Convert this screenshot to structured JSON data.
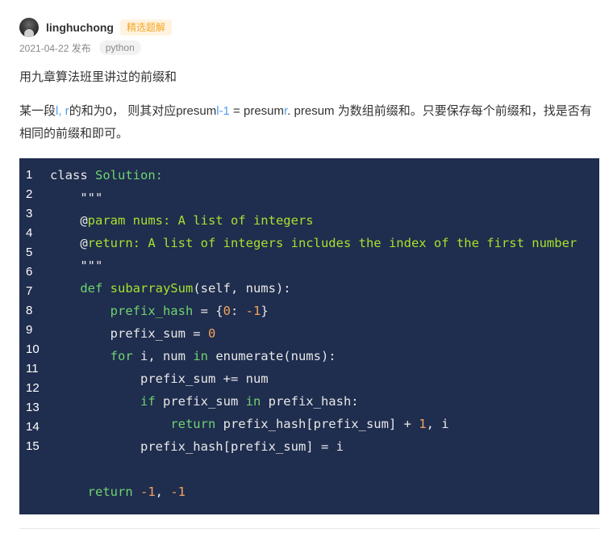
{
  "author": {
    "name": "linghuchong",
    "badge": "精选题解"
  },
  "meta": {
    "date_published": "2021-04-22 发布",
    "tag": "python"
  },
  "title": "用九章算法班里讲过的前缀和",
  "description": {
    "part1": "某一段",
    "hl1": "l, r",
    "part2": "的和为0， 则其对应presum",
    "hl2": "l-1",
    "part3": " = presum",
    "hl3": "r",
    "part4": ". presum 为数组前缀和。只要保存每个前缀和，找是否有相同的前缀和即可。"
  },
  "code": {
    "line_numbers": [
      "1",
      "2",
      "3",
      "4",
      "5",
      "6",
      "7",
      "8",
      "9",
      "10",
      "11",
      "12",
      "13",
      "14",
      "15"
    ],
    "lines": [
      {
        "indent": "",
        "tokens": [
          {
            "t": "class ",
            "c": "var"
          },
          {
            "t": "Solution:",
            "c": "kw"
          }
        ]
      },
      {
        "indent": "    ",
        "tokens": [
          {
            "t": "\"\"\"",
            "c": "var"
          }
        ]
      },
      {
        "indent": "    ",
        "tokens": [
          {
            "t": "@",
            "c": "var"
          },
          {
            "t": "param nums: A list of integers",
            "c": "doc"
          }
        ]
      },
      {
        "indent": "    ",
        "tokens": [
          {
            "t": "@",
            "c": "var"
          },
          {
            "t": "return: A list of integers includes the index of the first number",
            "c": "doc"
          }
        ]
      },
      {
        "indent": "    ",
        "tokens": [
          {
            "t": "\"\"\"",
            "c": "var"
          }
        ]
      },
      {
        "indent": "    ",
        "tokens": [
          {
            "t": "def ",
            "c": "kw"
          },
          {
            "t": "subarraySum",
            "c": "fn"
          },
          {
            "t": "(self, nums):",
            "c": "var"
          }
        ]
      },
      {
        "indent": "        ",
        "tokens": [
          {
            "t": "prefix_hash",
            "c": "kw"
          },
          {
            "t": " = {",
            "c": "var"
          },
          {
            "t": "0",
            "c": "num"
          },
          {
            "t": ": ",
            "c": "var"
          },
          {
            "t": "-1",
            "c": "num"
          },
          {
            "t": "}",
            "c": "var"
          }
        ]
      },
      {
        "indent": "        ",
        "tokens": [
          {
            "t": "prefix_sum = ",
            "c": "var"
          },
          {
            "t": "0",
            "c": "num"
          }
        ]
      },
      {
        "indent": "        ",
        "tokens": [
          {
            "t": "for ",
            "c": "kw"
          },
          {
            "t": "i, num ",
            "c": "var"
          },
          {
            "t": "in ",
            "c": "kw"
          },
          {
            "t": "enumerate(nums):",
            "c": "var"
          }
        ]
      },
      {
        "indent": "            ",
        "tokens": [
          {
            "t": "prefix_sum += num",
            "c": "var"
          }
        ]
      },
      {
        "indent": "            ",
        "tokens": [
          {
            "t": "if ",
            "c": "kw"
          },
          {
            "t": "prefix_sum ",
            "c": "var"
          },
          {
            "t": "in ",
            "c": "kw"
          },
          {
            "t": "prefix_hash:",
            "c": "var"
          }
        ]
      },
      {
        "indent": "                ",
        "tokens": [
          {
            "t": "return ",
            "c": "kw"
          },
          {
            "t": "prefix_hash[prefix_sum] + ",
            "c": "var"
          },
          {
            "t": "1",
            "c": "num"
          },
          {
            "t": ", i",
            "c": "var"
          }
        ]
      },
      {
        "indent": "            ",
        "tokens": [
          {
            "t": "prefix_hash[prefix_sum] = i",
            "c": "var"
          }
        ]
      },
      {
        "indent": "",
        "tokens": [
          {
            "t": "",
            "c": "var"
          }
        ]
      },
      {
        "indent": "     ",
        "tokens": [
          {
            "t": "return ",
            "c": "kw"
          },
          {
            "t": "-1",
            "c": "num"
          },
          {
            "t": ", ",
            "c": "var"
          },
          {
            "t": "-1",
            "c": "num"
          }
        ]
      }
    ]
  },
  "colors": {
    "code_background": "#1f2d4e",
    "keyword": "#6fd46f",
    "number": "#f5a35a",
    "highlight": "#4a9ff5",
    "badge_text": "#f5a623"
  }
}
